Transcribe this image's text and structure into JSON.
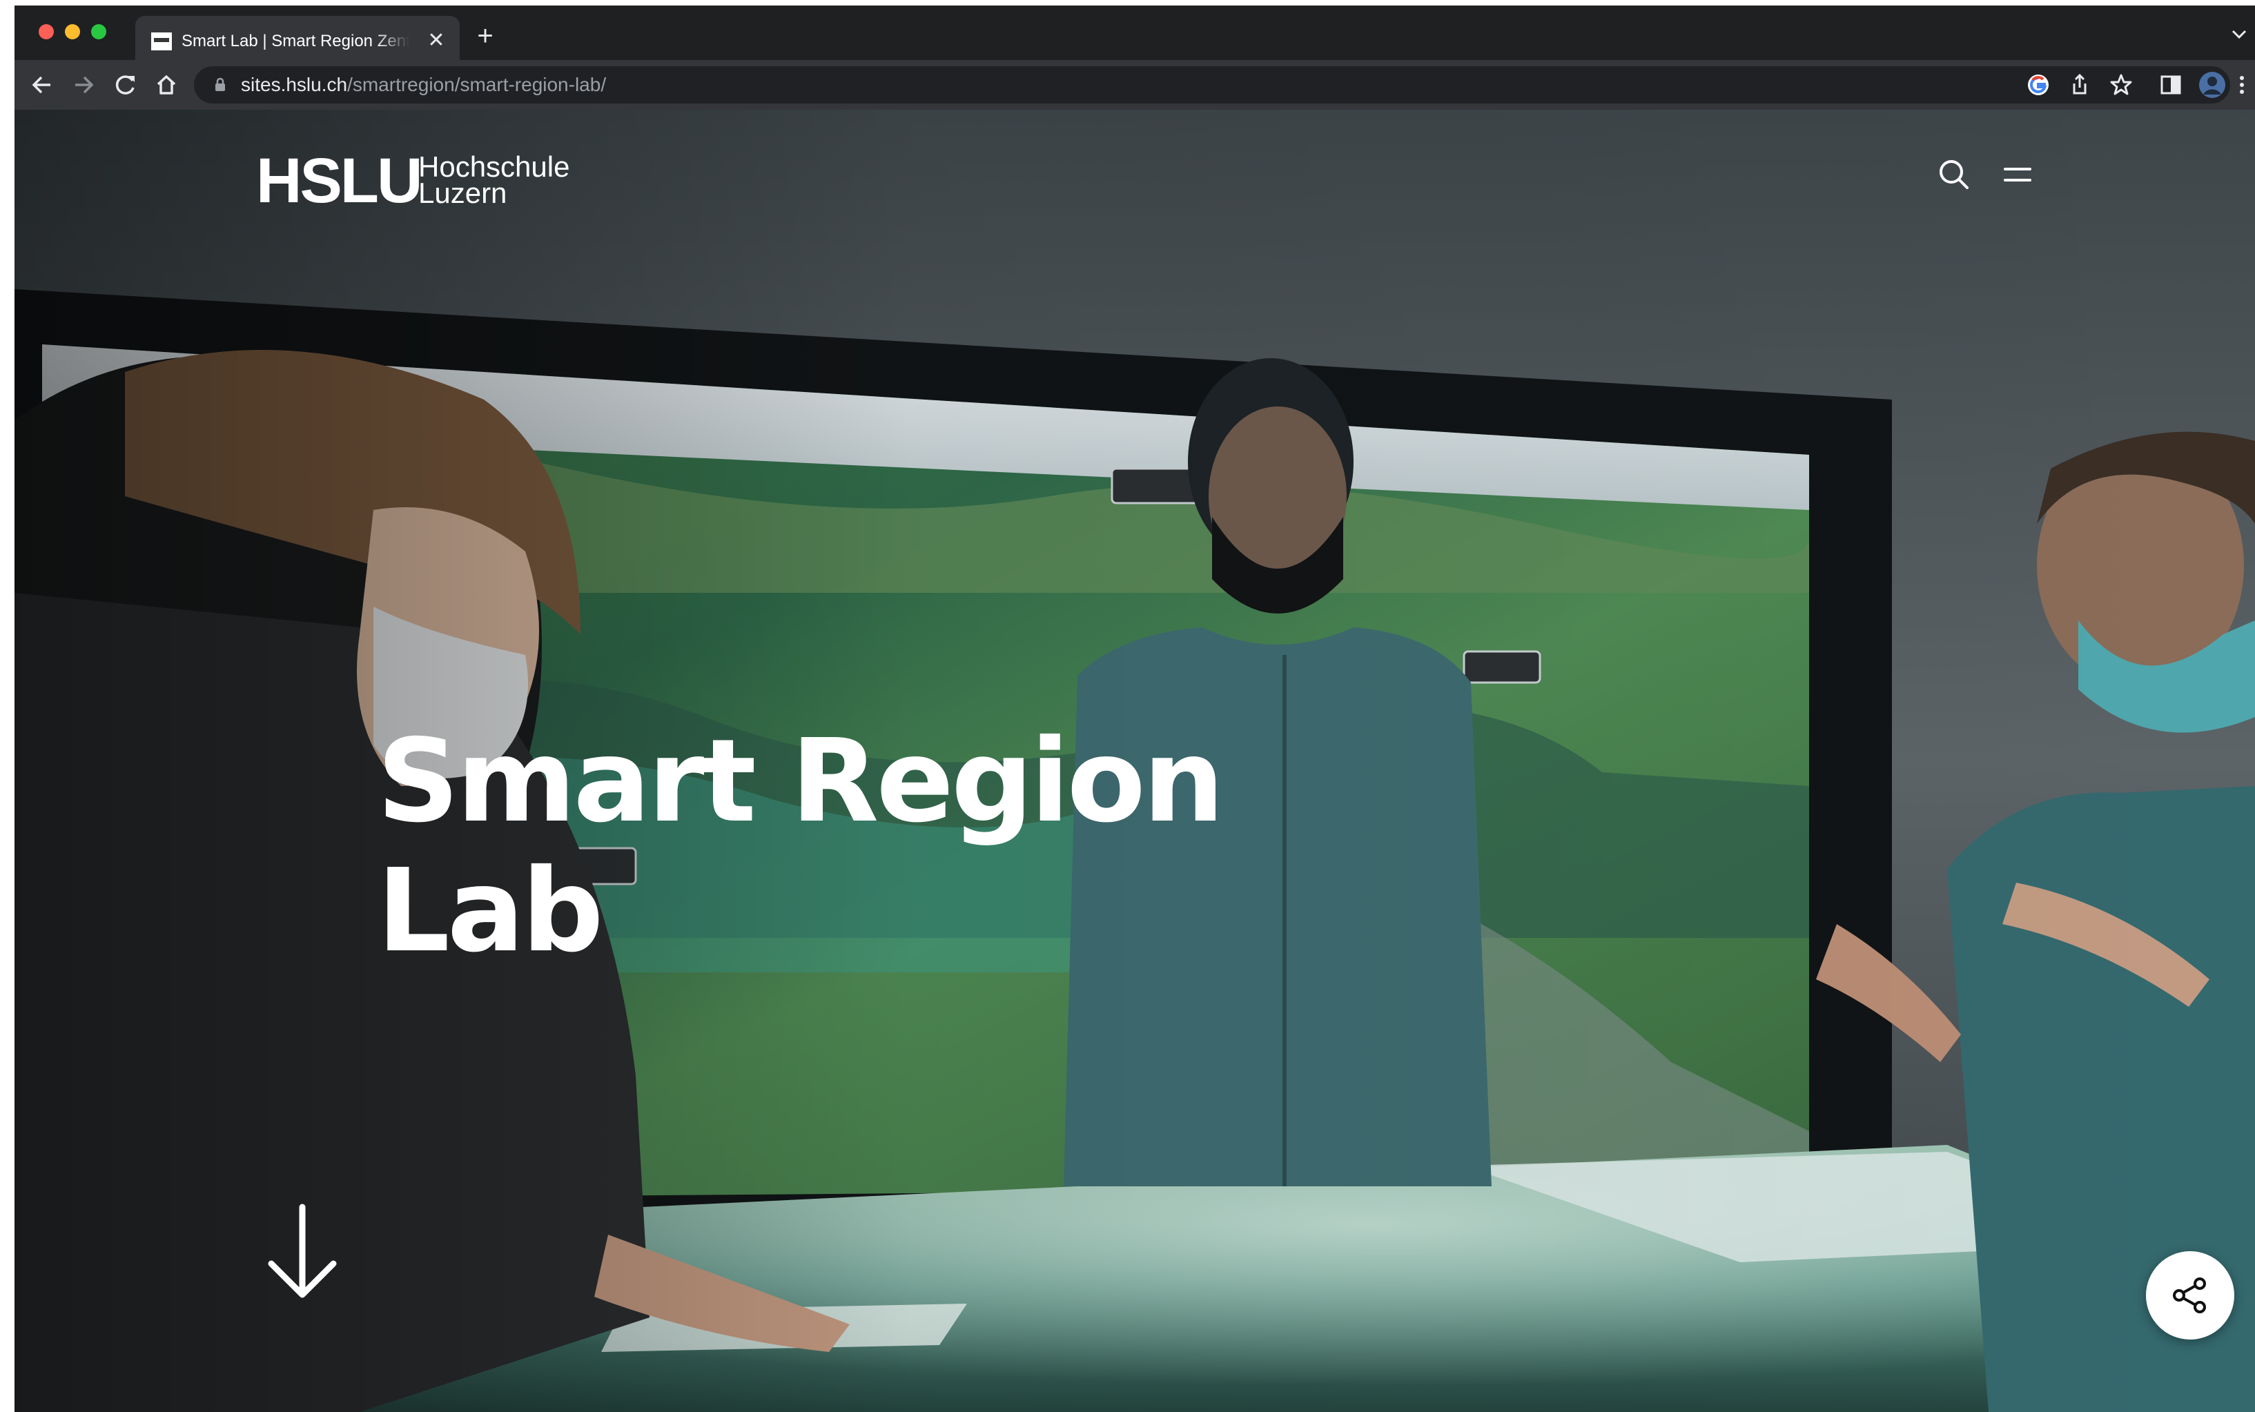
{
  "browser": {
    "tab": {
      "title": "Smart Lab | Smart Region Zentrum",
      "close_glyph": "✕"
    },
    "new_tab_glyph": "+",
    "address": {
      "host": "sites.hslu.ch",
      "path": "/smartregion/smart-region-lab/"
    },
    "icons": [
      "back-icon",
      "forward-icon",
      "reload-icon",
      "home-icon",
      "lock-icon",
      "google-icon",
      "share-icon",
      "bookmark-star-icon",
      "side-panel-icon",
      "profile-avatar",
      "more-icon"
    ]
  },
  "site": {
    "logo": {
      "mark": "HSLU",
      "line1": "Hochschule",
      "line2": "Luzern"
    },
    "hero": {
      "title_line1": "Smart Region",
      "title_line2": "Lab"
    }
  },
  "colors": {
    "accent": "#ffffff",
    "chrome_dark": "#1f2022",
    "toolbar": "#35363a",
    "omnibox": "#202124"
  }
}
